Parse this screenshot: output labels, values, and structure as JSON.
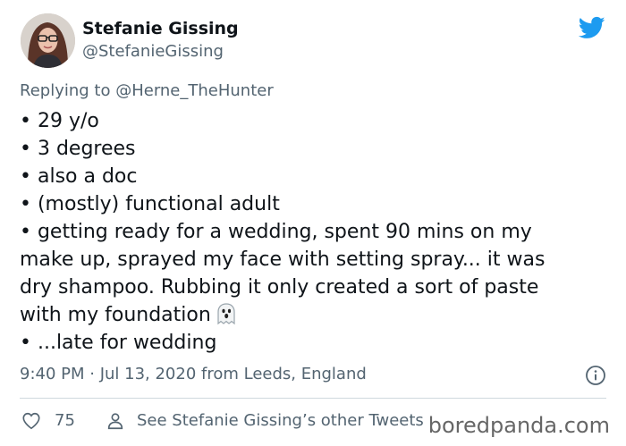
{
  "tweet": {
    "author_name": "Stefanie Gissing",
    "author_handle": "@StefanieGissing",
    "replying_prefix": "Replying to ",
    "replying_to": "@Herne_TheHunter",
    "lines": [
      "• 29 y/o",
      "• 3 degrees",
      "• also a doc",
      "• (mostly) functional adult",
      "• getting ready for a wedding, spent 90 mins on my",
      "make up, sprayed my face with setting spray... it was",
      "dry shampoo. Rubbing it only created a sort of paste",
      "with my foundation",
      "• ...late for wedding"
    ],
    "emoji_icon": "ghost-icon",
    "timestamp": "9:40 PM · Jul 13, 2020 from Leeds, England",
    "like_count": "75",
    "see_other": "See Stefanie Gissing’s other Tweets"
  },
  "icons": {
    "brand": "twitter-bird-icon",
    "info": "info-icon",
    "like": "heart-icon",
    "profile": "person-icon"
  },
  "watermark": "boredpanda.com",
  "colors": {
    "twitter_blue": "#1d9bf0",
    "text_primary": "#0f1419",
    "text_secondary": "#536471",
    "divider": "#cfd9de"
  }
}
